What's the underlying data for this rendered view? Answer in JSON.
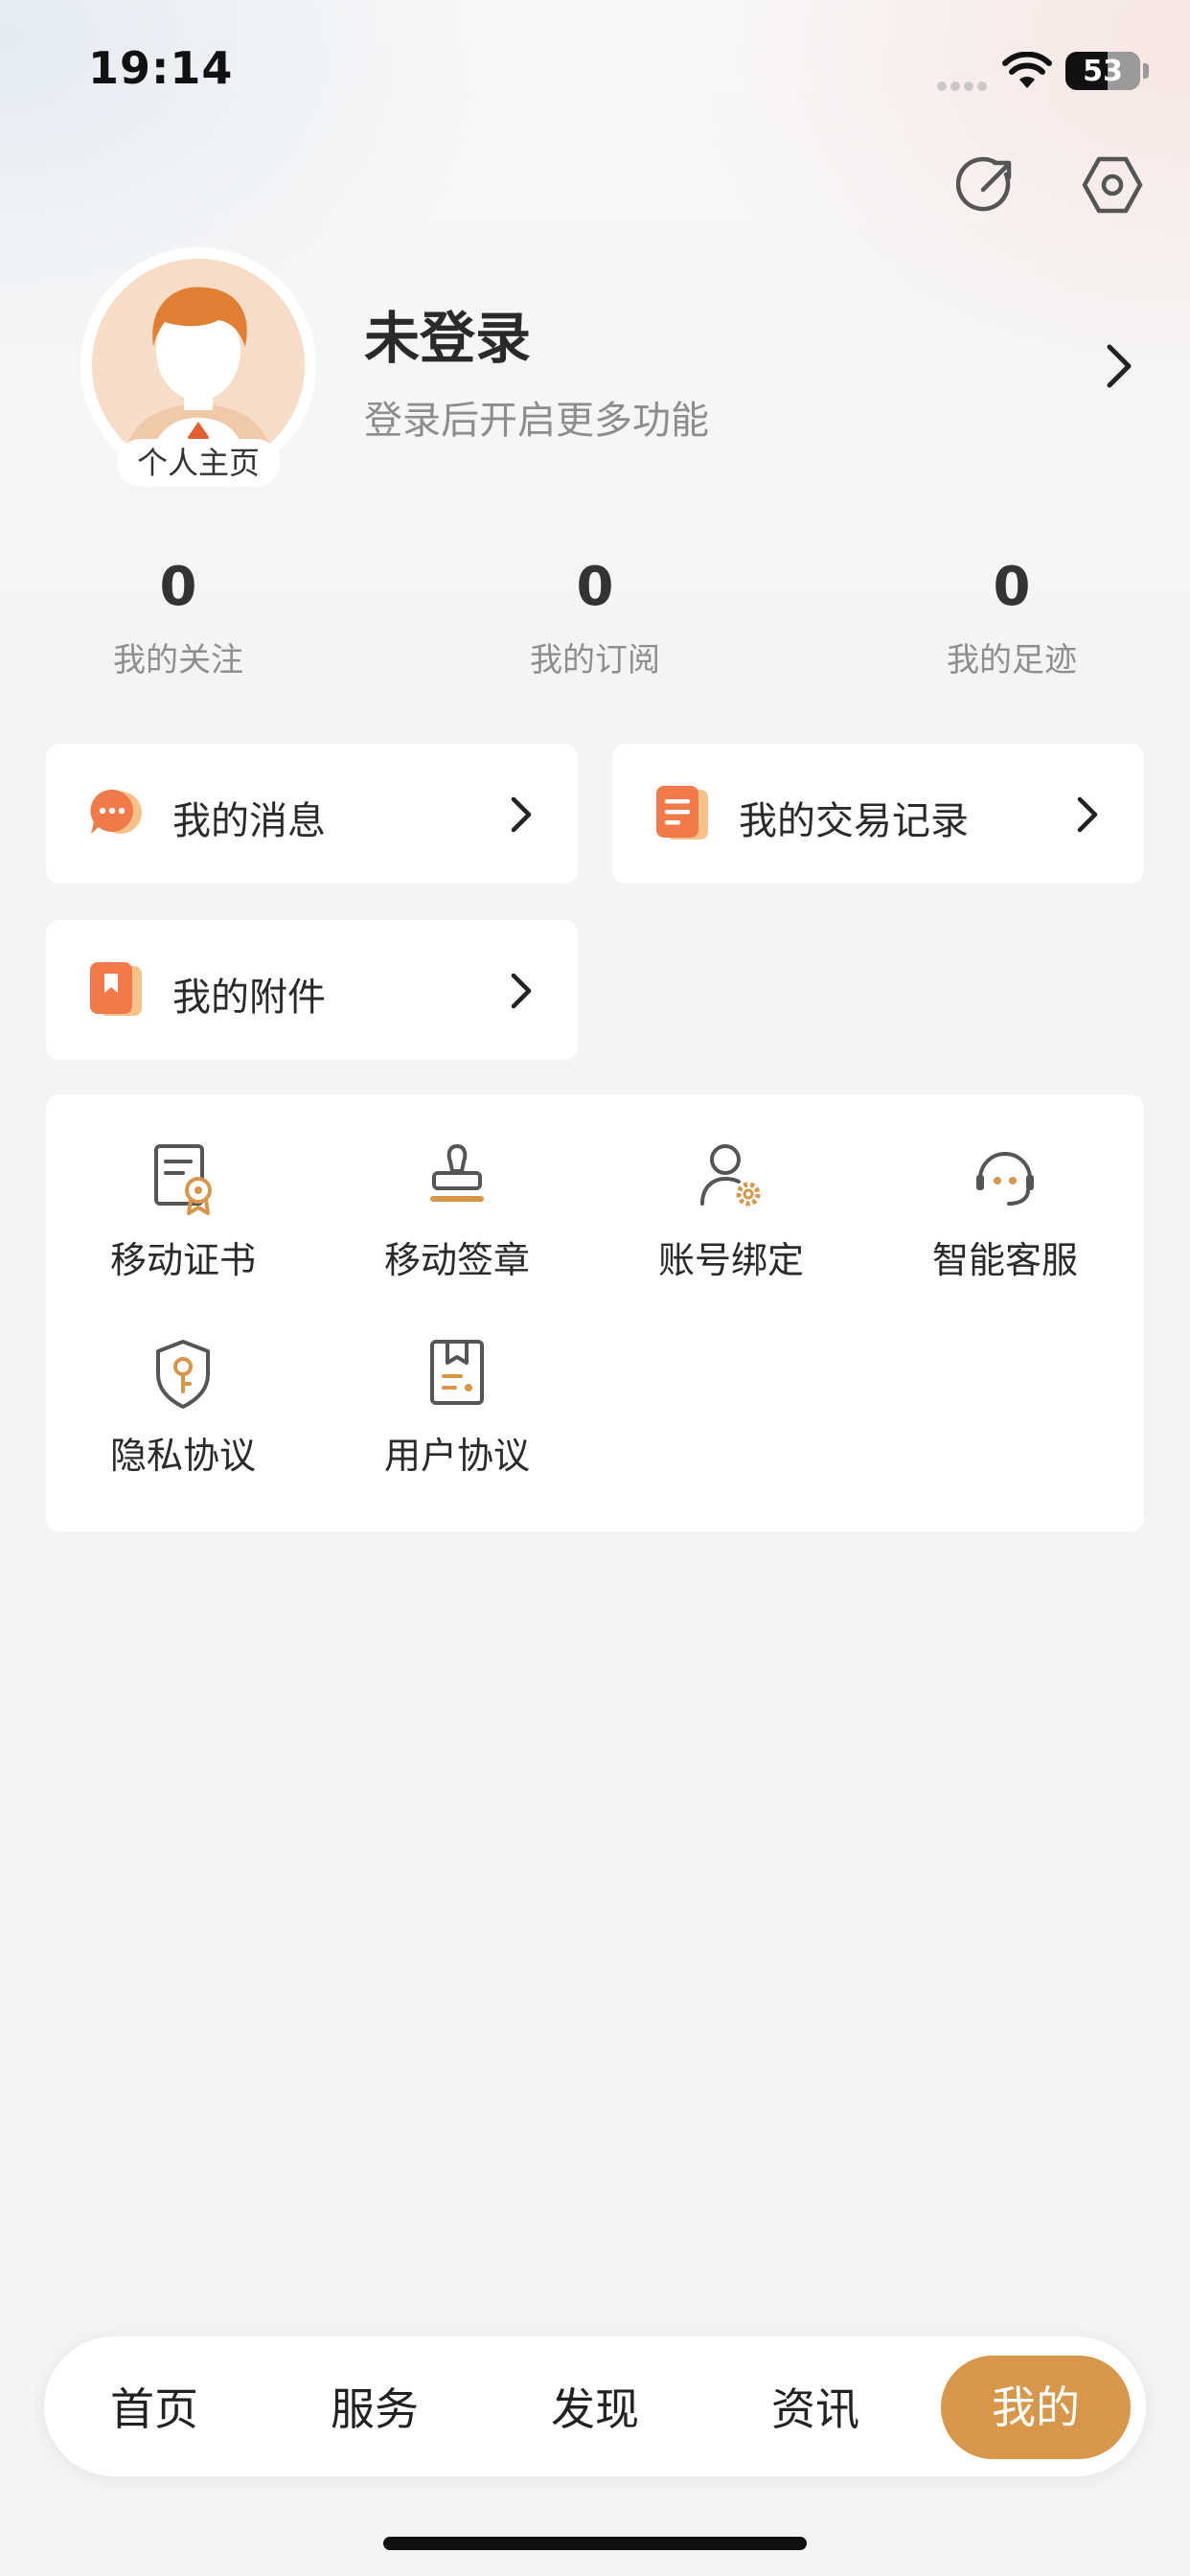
{
  "status_bar": {
    "time": "19:14",
    "battery": "53"
  },
  "profile": {
    "name": "未登录",
    "subtitle": "登录后开启更多功能",
    "avatar_tag": "个人主页"
  },
  "stats": [
    {
      "value": "0",
      "label": "我的关注"
    },
    {
      "value": "0",
      "label": "我的订阅"
    },
    {
      "value": "0",
      "label": "我的足迹"
    }
  ],
  "cards": {
    "messages": "我的消息",
    "transactions": "我的交易记录",
    "attachments": "我的附件"
  },
  "grid": [
    {
      "label": "移动证书",
      "icon": "certificate-icon"
    },
    {
      "label": "移动签章",
      "icon": "stamp-icon"
    },
    {
      "label": "账号绑定",
      "icon": "user-settings-icon"
    },
    {
      "label": "智能客服",
      "icon": "customer-service-icon"
    },
    {
      "label": "隐私协议",
      "icon": "privacy-shield-icon"
    },
    {
      "label": "用户协议",
      "icon": "user-agreement-icon"
    }
  ],
  "tabs": [
    {
      "label": "首页"
    },
    {
      "label": "服务"
    },
    {
      "label": "发现"
    },
    {
      "label": "资讯"
    },
    {
      "label": "我的",
      "active": true
    }
  ],
  "colors": {
    "accent": "#d8964b",
    "orange_icon": "#f07a4a",
    "background": "#f4f4f4"
  }
}
